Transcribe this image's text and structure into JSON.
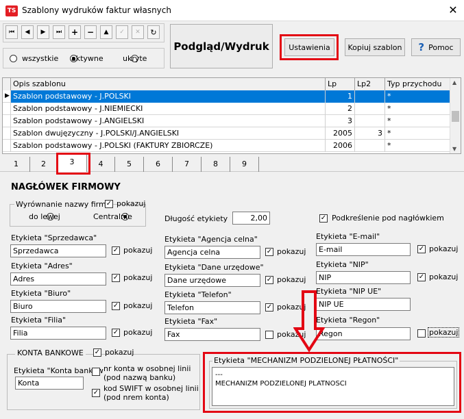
{
  "window": {
    "title": "Szablony wydruków faktur własnych",
    "icon_text": "TS",
    "close": "✕"
  },
  "toolbar": {
    "nav": [
      "⏮",
      "◀",
      "▶",
      "⏭",
      "+",
      "−",
      "▲",
      "✓",
      "✕",
      "↻"
    ],
    "preview_print": "Podgląd/Wydruk",
    "settings": "Ustawienia",
    "copy_template": "Kopiuj szablon",
    "help": "Pomoc",
    "help_icon": "?"
  },
  "filter": {
    "options": [
      "wszystkie",
      "aktywne",
      "ukryte"
    ],
    "selected": "aktywne"
  },
  "grid": {
    "headers": [
      "Opis szablonu",
      "Lp",
      "Lp2",
      "Typ przychodu"
    ],
    "rows": [
      [
        "Szablon podstawowy - J.POLSKI",
        "1",
        "",
        "*"
      ],
      [
        "Szablon podstawowy - J.NIEMIECKI",
        "2",
        "",
        "*"
      ],
      [
        "Szablon podstawowy - J.ANGIELSKI",
        "3",
        "",
        "*"
      ],
      [
        "Szablon dwujęzyczny - J.POLSKI/J.ANGIELSKI",
        "2005",
        "3",
        "*"
      ],
      [
        "Szablon podstawowy - J.POLSKI (FAKTURY ZBIORCZE)",
        "2006",
        "",
        "*"
      ]
    ],
    "selected_row": 0
  },
  "tabs": [
    "1",
    "2",
    "3",
    "4",
    "5",
    "6",
    "7",
    "8",
    "9"
  ],
  "active_tab": "3",
  "section": {
    "title": "NAGŁÓWEK FIRMOWY"
  },
  "align_group": {
    "label": "Wyrównanie nazwy firmy",
    "show_label": "pokazuj",
    "options": [
      "do lewej",
      "Centralnie"
    ],
    "selected": "Centralnie"
  },
  "label_length": {
    "label": "Długość etykiety",
    "value": "2,00"
  },
  "underline": {
    "label": "Podkreślenie pod nagłówkiem"
  },
  "show_text": "pokazuj",
  "fields": {
    "sprzedawca": {
      "label": "Etykieta \"Sprzedawca\"",
      "value": "Sprzedawca"
    },
    "adres": {
      "label": "Etykieta \"Adres\"",
      "value": "Adres"
    },
    "biuro": {
      "label": "Etykieta \"Biuro\"",
      "value": "Biuro"
    },
    "filia": {
      "label": "Etykieta \"Filia\"",
      "value": "Filia"
    },
    "agencja": {
      "label": "Etykieta \"Agencja celna\"",
      "value": "Agencja celna"
    },
    "dane": {
      "label": "Etykieta \"Dane urzędowe\"",
      "value": "Dane urzędowe"
    },
    "telefon": {
      "label": "Etykieta \"Telefon\"",
      "value": "Telefon"
    },
    "fax": {
      "label": "Etykieta \"Fax\"",
      "value": "Fax"
    },
    "email": {
      "label": "Etykieta \"E-mail\"",
      "value": "E-mail"
    },
    "nip": {
      "label": "Etykieta \"NIP\"",
      "value": "NIP"
    },
    "nipue": {
      "label": "Etykieta \"NIP UE\"",
      "value": "NIP UE"
    },
    "regon": {
      "label": "Etykieta \"Regon\"",
      "value": "Regon"
    }
  },
  "bank": {
    "label": "KONTA BANKOWE",
    "show_label": "pokazuj",
    "field_label": "Etykieta \"Konta bankow",
    "field_value": "Konta",
    "opt1_line1": "nr konta w osobnej linii",
    "opt1_line2": "(pod nazwą banku)",
    "opt2_line1": "kod SWIFT w osobnej linii",
    "opt2_line2": "(pod nrem konta)"
  },
  "mechanism": {
    "label": "Etykieta \"MECHANIZM PODZIELONEJ PŁATNOŚCI\"",
    "line1": "---",
    "line2": "MECHANIZM PODZIELONEJ PLATNOSCI"
  },
  "colors": {
    "highlight": "#e30613",
    "selection": "#0078d7",
    "help_icon": "#1a5fb4"
  }
}
